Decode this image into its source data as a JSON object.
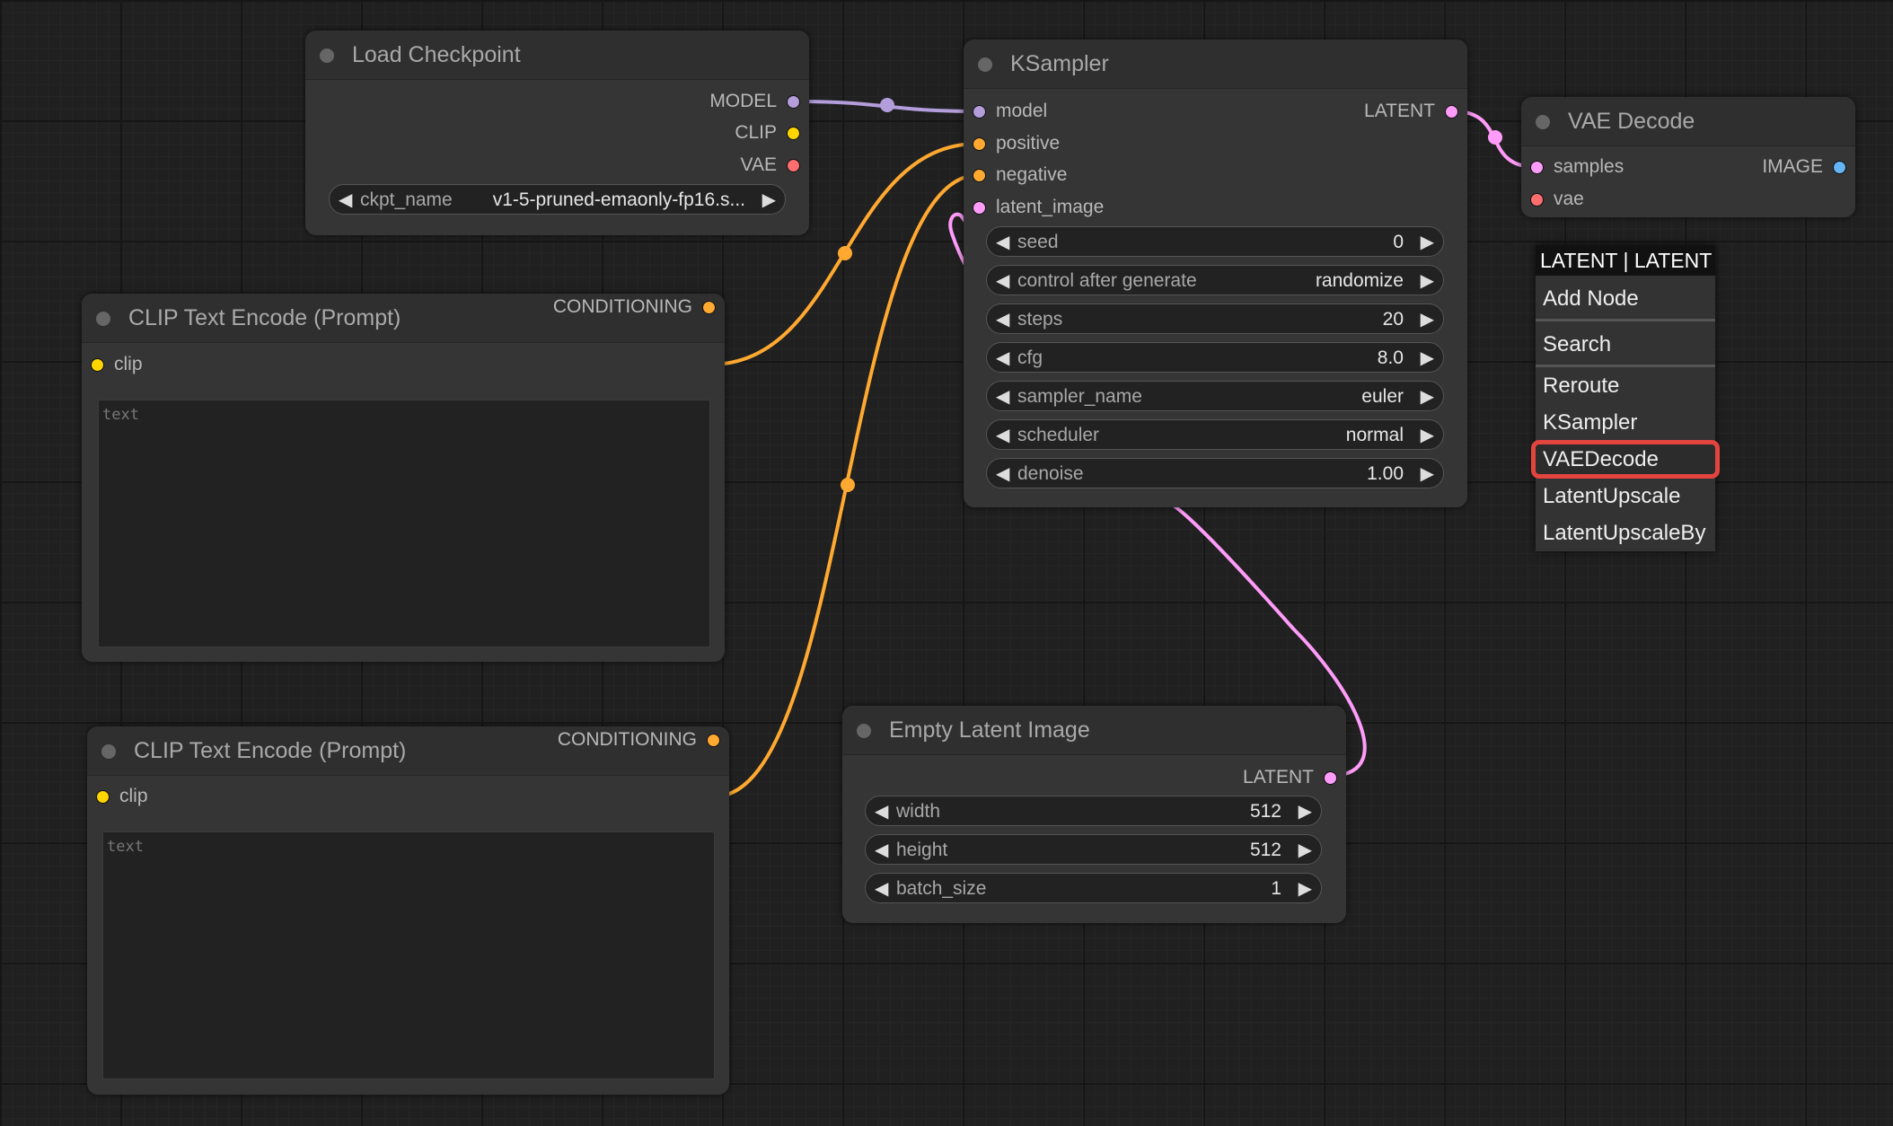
{
  "colors": {
    "MODEL": "#b39ddb",
    "CLIP": "#ffd500",
    "VAE": "#ff6e6e",
    "CONDITIONING": "#ffa931",
    "LATENT": "#ff9cf9",
    "IMAGE": "#64b5f6",
    "highlight": "#e2443f"
  },
  "nodes": {
    "load_checkpoint": {
      "title": "Load Checkpoint",
      "inputs": [],
      "outputs": [
        {
          "label": "MODEL",
          "type": "MODEL"
        },
        {
          "label": "CLIP",
          "type": "CLIP"
        },
        {
          "label": "VAE",
          "type": "VAE"
        }
      ],
      "widgets": [
        {
          "label": "ckpt_name",
          "value": "v1-5-pruned-emaonly-fp16.s..."
        }
      ]
    },
    "ksampler": {
      "title": "KSampler",
      "inputs": [
        {
          "label": "model",
          "type": "MODEL"
        },
        {
          "label": "positive",
          "type": "CONDITIONING"
        },
        {
          "label": "negative",
          "type": "CONDITIONING"
        },
        {
          "label": "latent_image",
          "type": "LATENT"
        }
      ],
      "outputs": [
        {
          "label": "LATENT",
          "type": "LATENT"
        }
      ],
      "widgets": [
        {
          "label": "seed",
          "value": "0"
        },
        {
          "label": "control after generate",
          "value": "randomize"
        },
        {
          "label": "steps",
          "value": "20"
        },
        {
          "label": "cfg",
          "value": "8.0"
        },
        {
          "label": "sampler_name",
          "value": "euler"
        },
        {
          "label": "scheduler",
          "value": "normal"
        },
        {
          "label": "denoise",
          "value": "1.00"
        }
      ]
    },
    "vae_decode": {
      "title": "VAE Decode",
      "inputs": [
        {
          "label": "samples",
          "type": "LATENT"
        },
        {
          "label": "vae",
          "type": "VAE"
        }
      ],
      "outputs": [
        {
          "label": "IMAGE",
          "type": "IMAGE"
        }
      ],
      "widgets": []
    },
    "clip_text_1": {
      "title": "CLIP Text Encode (Prompt)",
      "inputs": [
        {
          "label": "clip",
          "type": "CLIP"
        }
      ],
      "outputs": [
        {
          "label": "CONDITIONING",
          "type": "CONDITIONING"
        }
      ],
      "widgets": [],
      "text_placeholder": "text"
    },
    "clip_text_2": {
      "title": "CLIP Text Encode (Prompt)",
      "inputs": [
        {
          "label": "clip",
          "type": "CLIP"
        }
      ],
      "outputs": [
        {
          "label": "CONDITIONING",
          "type": "CONDITIONING"
        }
      ],
      "widgets": [],
      "text_placeholder": "text"
    },
    "empty_latent": {
      "title": "Empty Latent Image",
      "inputs": [],
      "outputs": [
        {
          "label": "LATENT",
          "type": "LATENT"
        }
      ],
      "widgets": [
        {
          "label": "width",
          "value": "512"
        },
        {
          "label": "height",
          "value": "512"
        },
        {
          "label": "batch_size",
          "value": "1"
        }
      ]
    }
  },
  "context_menu": {
    "header": "LATENT | LATENT",
    "items": [
      {
        "label": "Add Node"
      },
      {
        "label": "Search"
      },
      {
        "label": "Reroute"
      },
      {
        "label": "KSampler"
      },
      {
        "label": "VAEDecode",
        "highlighted": true
      },
      {
        "label": "LatentUpscale"
      },
      {
        "label": "LatentUpscaleBy"
      }
    ]
  }
}
